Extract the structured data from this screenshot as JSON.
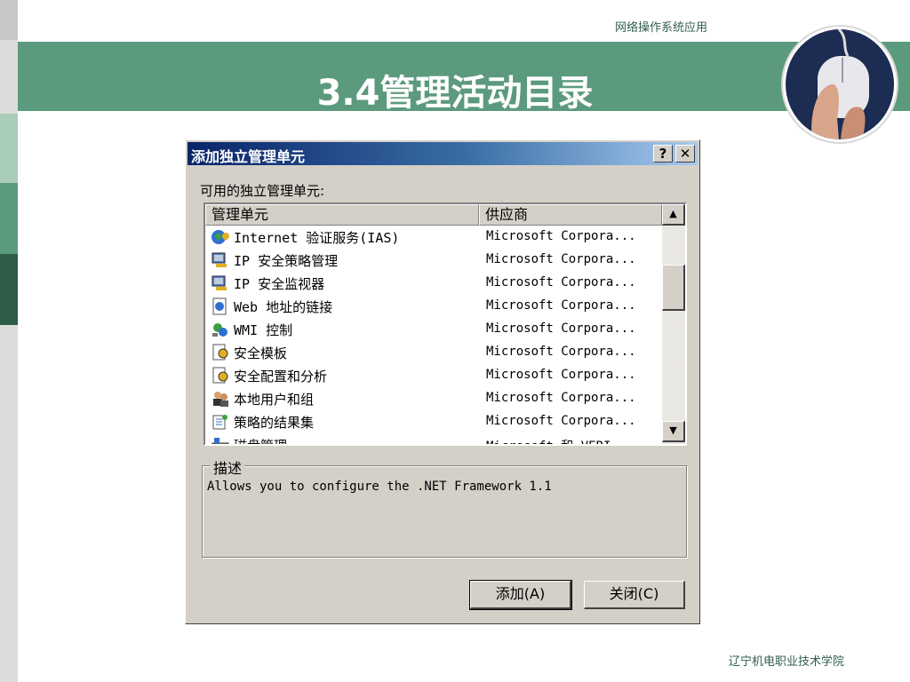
{
  "slide": {
    "course_name": "网络操作系统应用",
    "title": "3.4管理活动目录",
    "college": "辽宁机电职业技术学院"
  },
  "dialog": {
    "title": "添加独立管理单元",
    "help_button": "?",
    "close_button": "✕",
    "available_label": "可用的独立管理单元:",
    "columns": {
      "name": "管理单元",
      "vendor": "供应商"
    },
    "snapins": [
      {
        "name": "Internet 验证服务(IAS)",
        "vendor": "Microsoft Corpora...",
        "icon": "ias-icon"
      },
      {
        "name": "IP 安全策略管理",
        "vendor": "Microsoft Corpora...",
        "icon": "ip-security-policy-icon"
      },
      {
        "name": "IP 安全监视器",
        "vendor": "Microsoft Corpora...",
        "icon": "ip-security-monitor-icon"
      },
      {
        "name": "Web 地址的链接",
        "vendor": "Microsoft Corpora...",
        "icon": "web-link-icon"
      },
      {
        "name": "WMI 控制",
        "vendor": "Microsoft Corpora...",
        "icon": "wmi-control-icon"
      },
      {
        "name": "安全模板",
        "vendor": "Microsoft Corpora...",
        "icon": "security-templates-icon"
      },
      {
        "name": "安全配置和分析",
        "vendor": "Microsoft Corpora...",
        "icon": "security-config-icon"
      },
      {
        "name": "本地用户和组",
        "vendor": "Microsoft Corpora...",
        "icon": "local-users-icon"
      },
      {
        "name": "策略的结果集",
        "vendor": "Microsoft Corpora...",
        "icon": "rsop-icon"
      },
      {
        "name": "磁盘管理",
        "vendor": "Microsoft 和 VERI...",
        "icon": "disk-management-icon"
      }
    ],
    "description_legend": "描述",
    "description_text": "Allows you to configure the .NET Framework 1.1",
    "add_button": "添加(A)",
    "close_dialog_button": "关闭(C)"
  }
}
